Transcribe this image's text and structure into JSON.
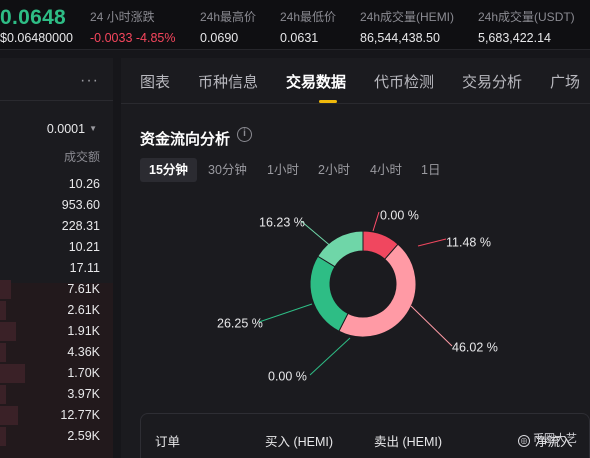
{
  "header": {
    "price": "0.0648",
    "price_sub": "$0.06480000",
    "stats": [
      {
        "label": "24 小时涨跌",
        "value": "-0.0033 -4.85%",
        "negative": true
      },
      {
        "label": "24h最高价",
        "value": "0.0690"
      },
      {
        "label": "24h最低价",
        "value": "0.0631"
      },
      {
        "label": "24h成交量(HEMI)",
        "value": "86,544,438.50"
      },
      {
        "label": "24h成交量(USDT)",
        "value": "5,683,422.14"
      }
    ]
  },
  "orderbook": {
    "more_icon": "more-dots-icon",
    "precision": "0.0001",
    "column_header": "成交额",
    "rows": [
      {
        "value": "10.26",
        "depth": 0
      },
      {
        "value": "953.60",
        "depth": 0
      },
      {
        "value": "228.31",
        "depth": 0
      },
      {
        "value": "10.21",
        "depth": 0
      },
      {
        "value": "17.11",
        "depth": 0
      },
      {
        "value": "7.61K",
        "depth": 0.1
      },
      {
        "value": "2.61K",
        "depth": 0.05
      },
      {
        "value": "1.91K",
        "depth": 0.14
      },
      {
        "value": "4.36K",
        "depth": 0.05
      },
      {
        "value": "1.70K",
        "depth": 0.22
      },
      {
        "value": "3.97K",
        "depth": 0.05
      },
      {
        "value": "12.77K",
        "depth": 0.16
      },
      {
        "value": "2.59K",
        "depth": 0.05
      }
    ]
  },
  "tabs": [
    "图表",
    "币种信息",
    "交易数据",
    "代币检测",
    "交易分析",
    "广场"
  ],
  "active_tab": 2,
  "fund_flow": {
    "title": "资金流向分析",
    "info_icon": "info-icon",
    "intervals": [
      "15分钟",
      "30分钟",
      "1小时",
      "2小时",
      "4小时",
      "1日"
    ],
    "active_interval": 0
  },
  "chart_data": {
    "type": "pie",
    "subtype": "donut",
    "title": "",
    "slices": [
      {
        "label": "0.00 %",
        "value": 0.0,
        "color": "#ff4d6a"
      },
      {
        "label": "11.48 %",
        "value": 11.48,
        "color": "#f0475f"
      },
      {
        "label": "46.02 %",
        "value": 46.02,
        "color": "#ff9aa5"
      },
      {
        "label": "0.00 %",
        "value": 0.0,
        "color": "#2ebd85"
      },
      {
        "label": "26.25 %",
        "value": 26.25,
        "color": "#2ebd85"
      },
      {
        "label": "16.23 %",
        "value": 16.23,
        "color": "#6fd6a8"
      }
    ]
  },
  "table": {
    "headers": [
      "订单",
      "买入 (HEMI)",
      "卖出 (HEMI)",
      "净流入"
    ]
  },
  "watermark": "币圈大艺"
}
